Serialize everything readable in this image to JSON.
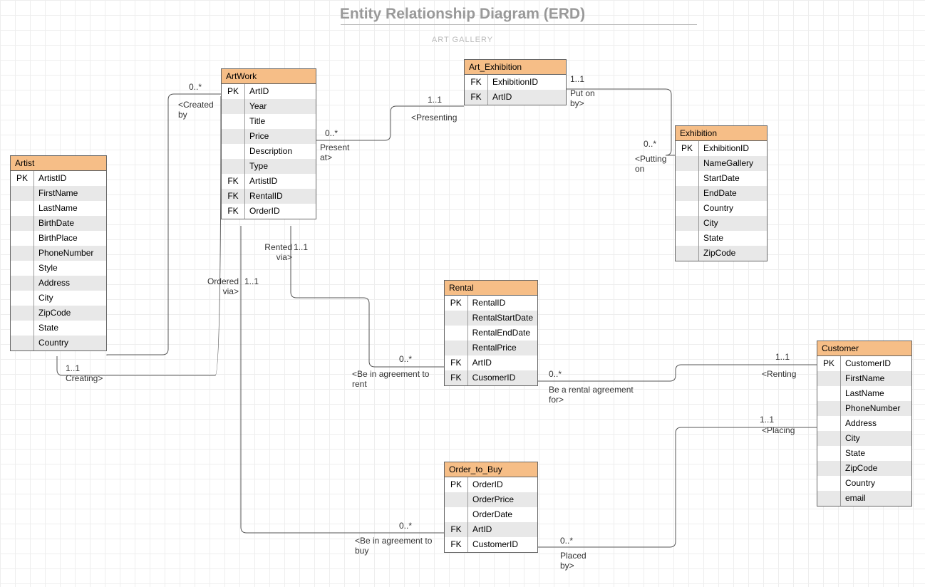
{
  "header": {
    "title": "Entity Relationship Diagram (ERD)",
    "subtitle": "ART GALLERY"
  },
  "entities": {
    "artist": {
      "name": "Artist",
      "rows": [
        {
          "k": "PK",
          "n": "ArtistID"
        },
        {
          "k": "",
          "n": "FirstName"
        },
        {
          "k": "",
          "n": "LastName"
        },
        {
          "k": "",
          "n": "BirthDate"
        },
        {
          "k": "",
          "n": "BirthPlace"
        },
        {
          "k": "",
          "n": "PhoneNumber"
        },
        {
          "k": "",
          "n": "Style"
        },
        {
          "k": "",
          "n": "Address"
        },
        {
          "k": "",
          "n": "City"
        },
        {
          "k": "",
          "n": "ZipCode"
        },
        {
          "k": "",
          "n": "State"
        },
        {
          "k": "",
          "n": "Country"
        }
      ]
    },
    "artwork": {
      "name": "ArtWork",
      "rows": [
        {
          "k": "PK",
          "n": "ArtID"
        },
        {
          "k": "",
          "n": "Year"
        },
        {
          "k": "",
          "n": "Title"
        },
        {
          "k": "",
          "n": "Price"
        },
        {
          "k": "",
          "n": "Description"
        },
        {
          "k": "",
          "n": "Type"
        },
        {
          "k": "FK",
          "n": "ArtistID"
        },
        {
          "k": "FK",
          "n": "RentalID"
        },
        {
          "k": "FK",
          "n": "OrderID"
        }
      ]
    },
    "art_exhibition": {
      "name": "Art_Exhibition",
      "rows": [
        {
          "k": "FK",
          "n": "ExhibitionID"
        },
        {
          "k": "FK",
          "n": "ArtID"
        }
      ]
    },
    "exhibition": {
      "name": "Exhibition",
      "rows": [
        {
          "k": "PK",
          "n": "ExhibitionID"
        },
        {
          "k": "",
          "n": "NameGallery"
        },
        {
          "k": "",
          "n": "StartDate"
        },
        {
          "k": "",
          "n": "EndDate"
        },
        {
          "k": "",
          "n": "Country"
        },
        {
          "k": "",
          "n": "City"
        },
        {
          "k": "",
          "n": "State"
        },
        {
          "k": "",
          "n": "ZipCode"
        }
      ]
    },
    "rental": {
      "name": "Rental",
      "rows": [
        {
          "k": "PK",
          "n": "RentalID"
        },
        {
          "k": "",
          "n": "RentalStartDate"
        },
        {
          "k": "",
          "n": "RentalEndDate"
        },
        {
          "k": "",
          "n": "RentalPrice"
        },
        {
          "k": "FK",
          "n": "ArtID"
        },
        {
          "k": "FK",
          "n": "CusomerID"
        }
      ]
    },
    "order": {
      "name": "Order_to_Buy",
      "rows": [
        {
          "k": "PK",
          "n": "OrderID"
        },
        {
          "k": "",
          "n": "OrderPrice"
        },
        {
          "k": "",
          "n": "OrderDate"
        },
        {
          "k": "FK",
          "n": "ArtID"
        },
        {
          "k": "FK",
          "n": "CustomerID"
        }
      ]
    },
    "customer": {
      "name": "Customer",
      "rows": [
        {
          "k": "PK",
          "n": "CustomerID"
        },
        {
          "k": "",
          "n": "FirstName"
        },
        {
          "k": "",
          "n": "LastName"
        },
        {
          "k": "",
          "n": "PhoneNumber"
        },
        {
          "k": "",
          "n": "Address"
        },
        {
          "k": "",
          "n": "City"
        },
        {
          "k": "",
          "n": "State"
        },
        {
          "k": "",
          "n": "ZipCode"
        },
        {
          "k": "",
          "n": "Country"
        },
        {
          "k": "",
          "n": "email"
        }
      ]
    }
  },
  "labels": {
    "l1": "0..*",
    "l2": "<Created by",
    "l3": "1..1",
    "l4": "Creating>",
    "l5": "1..1",
    "l6": "<Presenting",
    "l7": "0..*",
    "l8": "Present at>",
    "l9": "1..1",
    "l10": "Put on by>",
    "l11": "0..*",
    "l12": "<Putting on",
    "l13": "Rented via>",
    "l14": "1..1",
    "l15": "Ordered via>",
    "l16": "1..1",
    "l17": "0..*",
    "l18": "<Be in agreement to rent",
    "l19": "0..*",
    "l20": "Be a rental agreement for>",
    "l21": "1..1",
    "l22": "<Renting",
    "l23": "0..*",
    "l24": "<Be in agreement to buy",
    "l25": "0..*",
    "l26": "Placed by>",
    "l27": "1..1",
    "l28": "<Placing"
  }
}
